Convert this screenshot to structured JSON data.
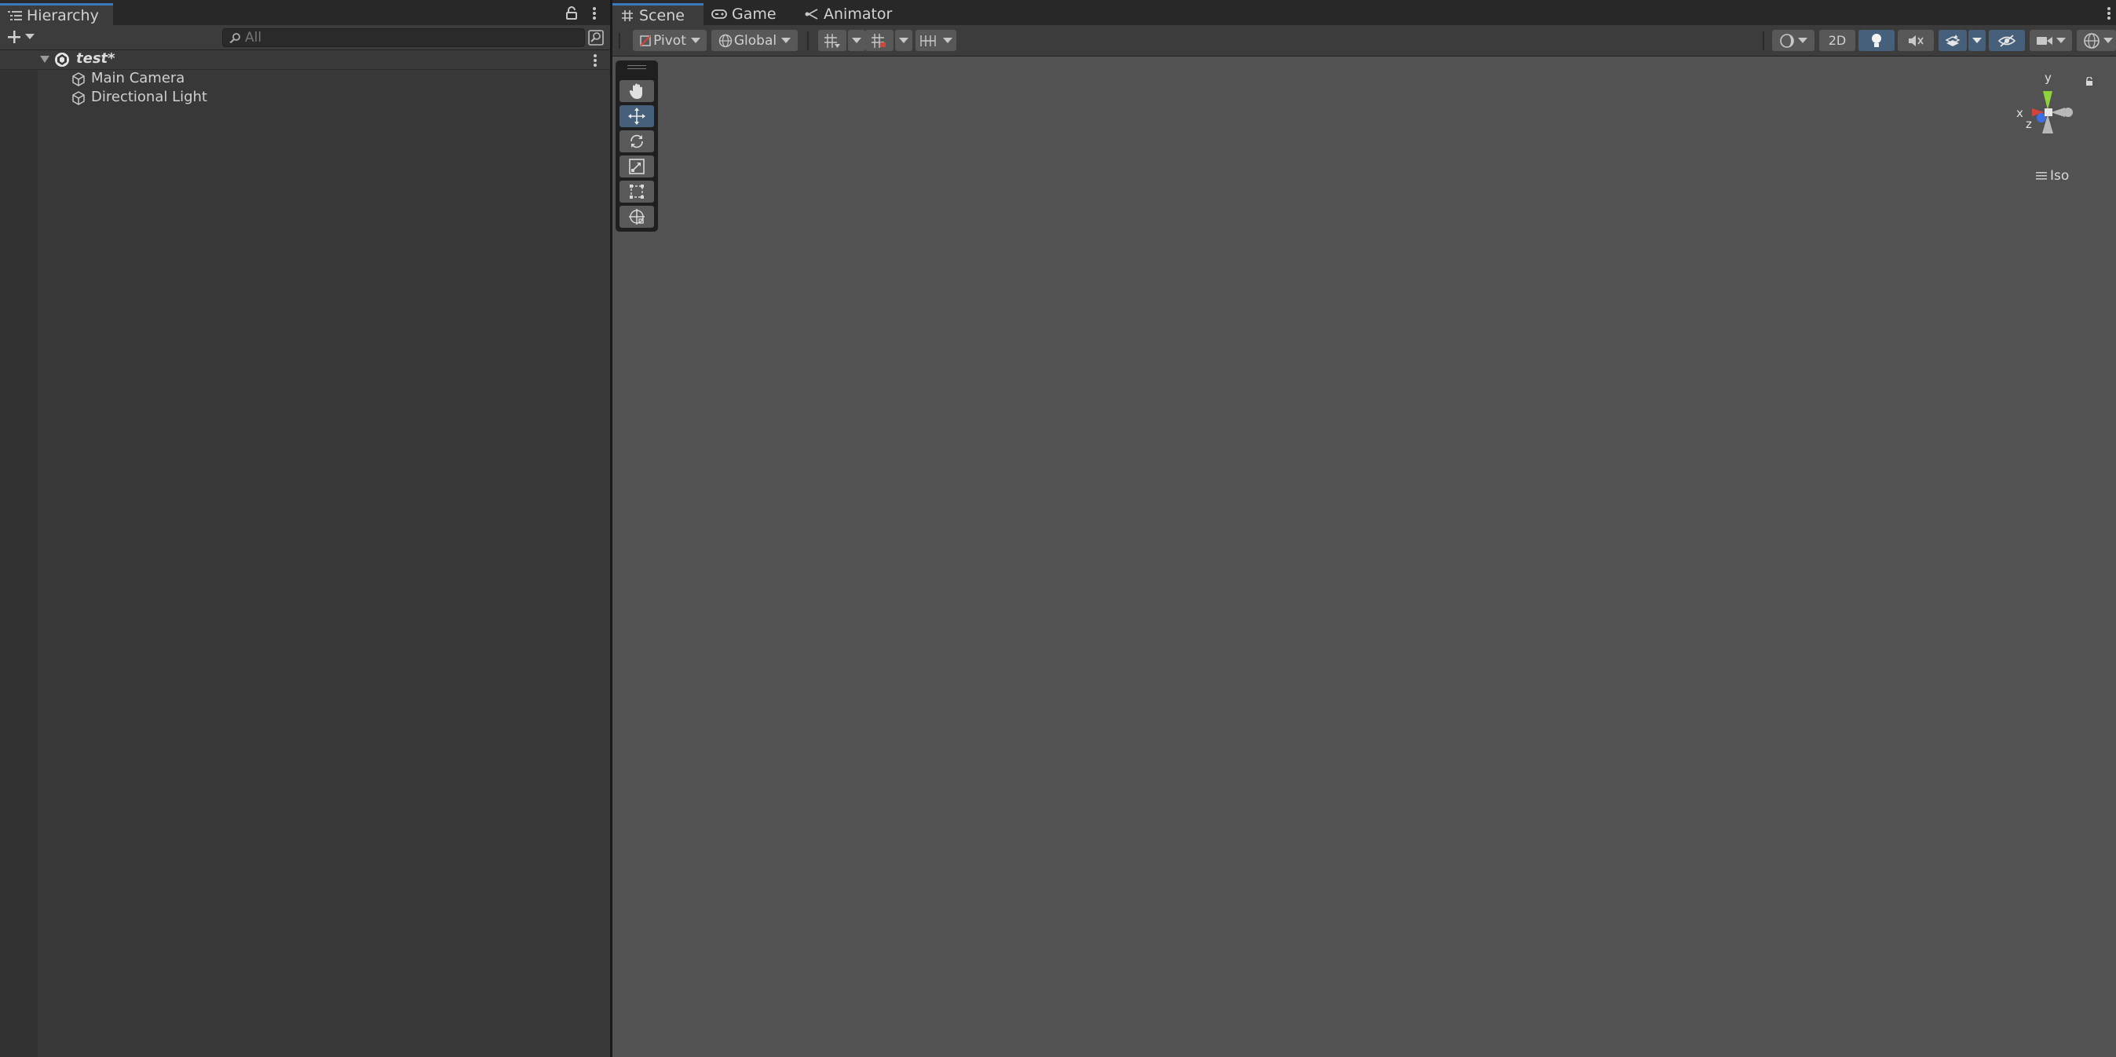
{
  "hierarchy": {
    "tab_label": "Hierarchy",
    "search_placeholder": "All",
    "scene_name": "test*",
    "items": [
      {
        "label": "Main Camera"
      },
      {
        "label": "Directional Light"
      }
    ]
  },
  "scene_view": {
    "tabs": [
      {
        "label": "Scene"
      },
      {
        "label": "Game"
      },
      {
        "label": "Animator"
      }
    ],
    "pivot_label": "Pivot",
    "global_label": "Global",
    "mode_2d_label": "2D",
    "gizmo": {
      "y_label": "y",
      "x_label": "x",
      "z_label": "z",
      "projection_label": "Iso"
    }
  },
  "colors": {
    "accent": "#3a79bb",
    "selected": "#46607c",
    "gizmo_x": "#d0453c",
    "gizmo_y": "#8fd33b",
    "gizmo_z": "#3c6fe0"
  },
  "icons": [
    "list-icon",
    "lock-icon",
    "kebab-icon",
    "plus-icon",
    "chevron-down-icon",
    "search-icon",
    "scene-search-icon",
    "unity-scene-icon",
    "gameobject-icon",
    "hash-icon",
    "gamepad-icon",
    "animator-icon",
    "pivot-icon",
    "globe-icon",
    "grid-snap-icon",
    "grid-icon",
    "snap-increment-icon",
    "shading-icon",
    "light-icon",
    "audio-icon",
    "effects-icon",
    "visibility-icon",
    "camera-icon",
    "gizmos-icon",
    "hand-tool-icon",
    "move-tool-icon",
    "rotate-tool-icon",
    "scale-tool-icon",
    "rect-tool-icon",
    "transform-tool-icon"
  ]
}
